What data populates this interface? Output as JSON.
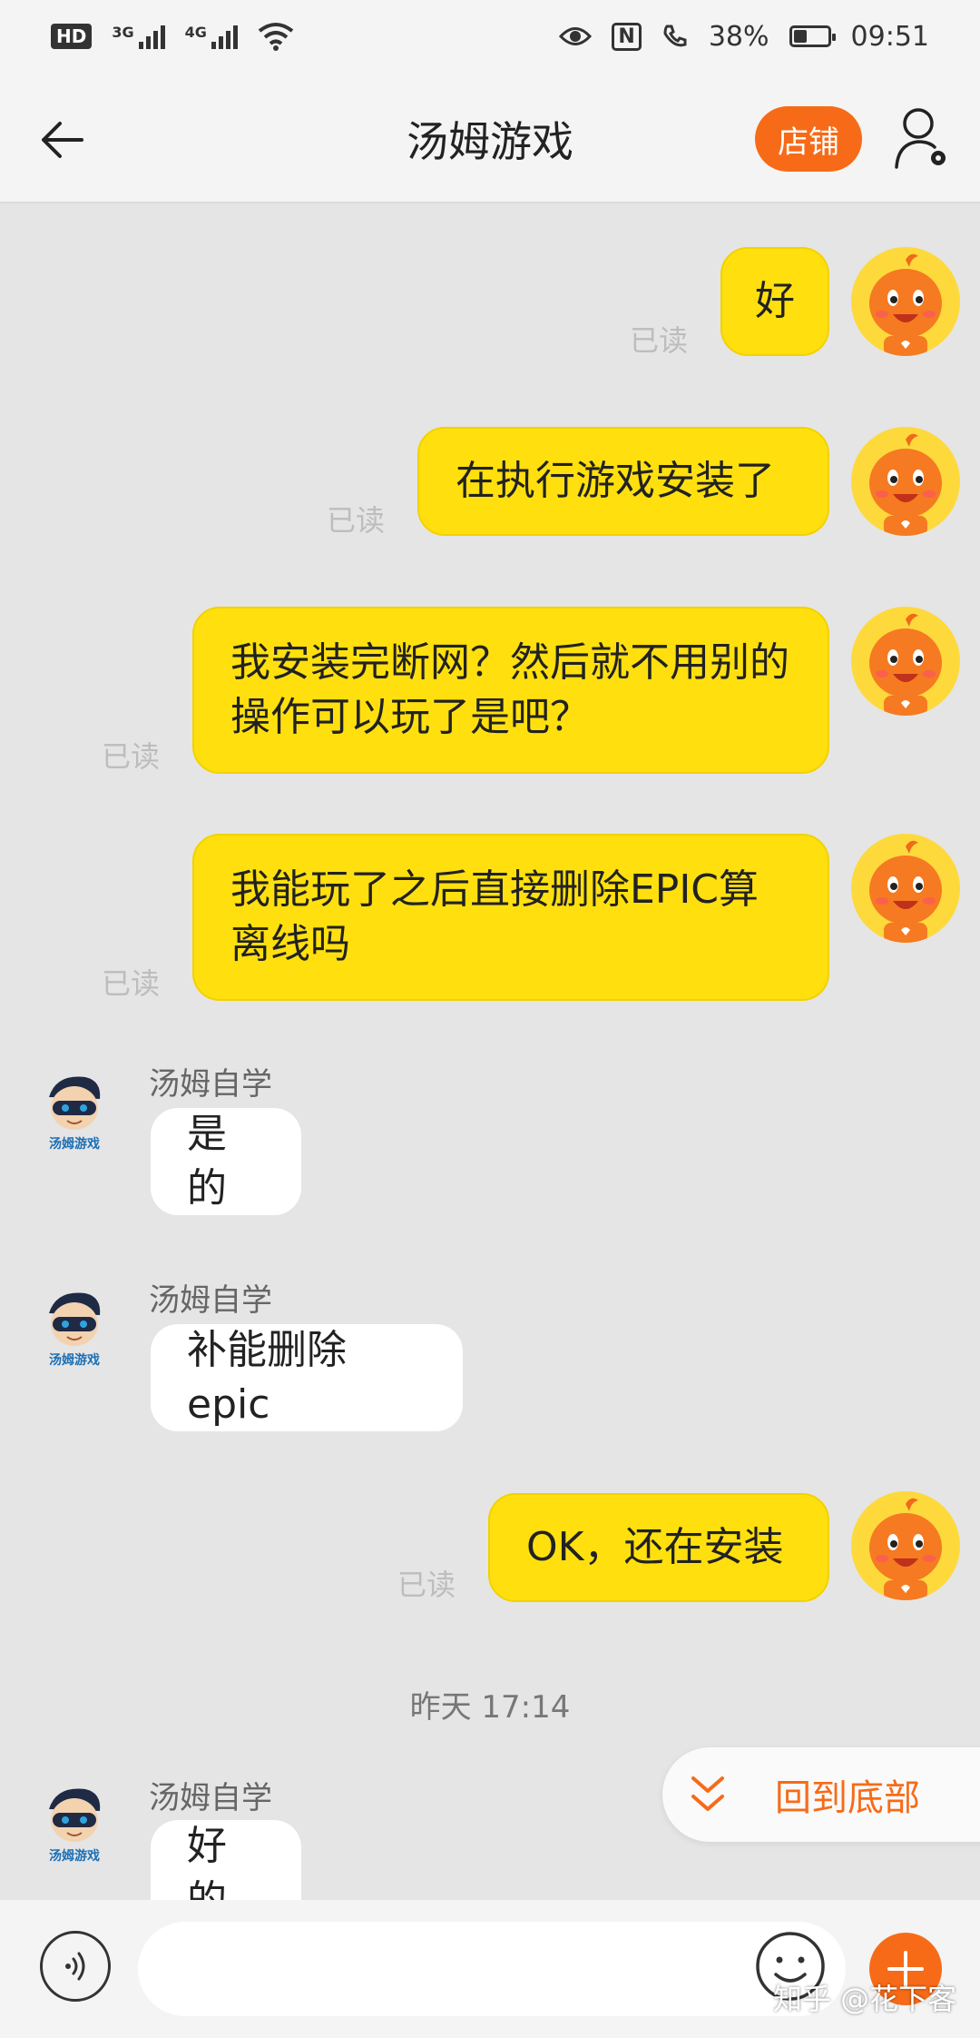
{
  "status_bar": {
    "hd": "HD",
    "sim1": "3G",
    "sim2": "4G",
    "nfc": "N",
    "battery_percent": "38%",
    "battery_level": 0.38,
    "time": "09:51"
  },
  "header": {
    "title": "汤姆游戏",
    "shop_label": "店铺"
  },
  "messages": [
    {
      "side": "me",
      "text": "好",
      "read": "已读"
    },
    {
      "side": "me",
      "text": "在执行游戏安装了",
      "read": "已读"
    },
    {
      "side": "me",
      "text": "我安装完断网？然后就不用别的操作可以玩了是吧？",
      "read": "已读"
    },
    {
      "side": "me",
      "text": "我能玩了之后直接删除EPIC算离线吗",
      "read": "已读"
    },
    {
      "side": "them",
      "sender": "汤姆自学",
      "text": "是的"
    },
    {
      "side": "them",
      "sender": "汤姆自学",
      "text": "补能删除epic"
    },
    {
      "side": "me",
      "text": "OK，还在安装",
      "read": "已读"
    },
    {
      "side": "them",
      "sender": "汤姆自学",
      "text": "好的"
    }
  ],
  "time_divider": "昨天  17:14",
  "back_to_bottom_label": "回到底部",
  "input": {
    "placeholder": ""
  },
  "watermark": "知乎 @花下客",
  "colors": {
    "accent": "#f76b18",
    "my_bubble": "#ffe00e",
    "their_bubble": "#ffffff",
    "background": "#e5e5e5"
  },
  "icons": {
    "back": "arrow-left-icon",
    "profile": "user-settings-icon",
    "voice": "voice-icon",
    "emoji": "smiley-icon",
    "plus": "plus-icon",
    "back_to_bottom": "double-chevron-down-icon"
  }
}
